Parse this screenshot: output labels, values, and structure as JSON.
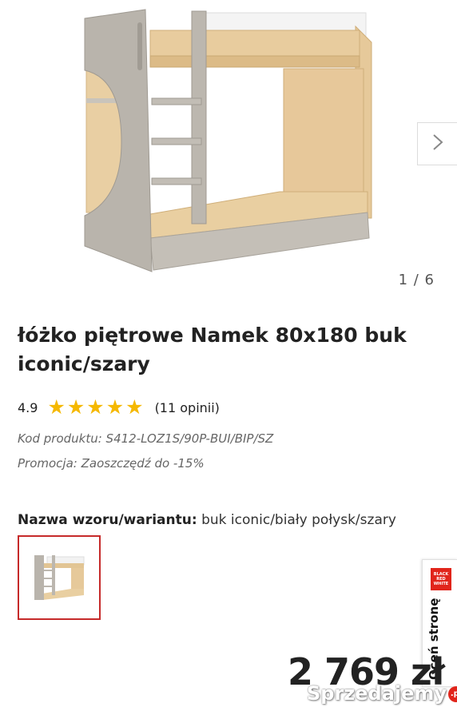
{
  "gallery": {
    "counter": "1 / 6",
    "next_icon": "chevron-right-icon",
    "image": "bunk-bed-product-photo"
  },
  "product": {
    "title": "łóżko piętrowe Namek 80x180 buk iconic/szary",
    "rating_value": "4.9",
    "stars": 5,
    "reviews": "(11 opinii)",
    "code": "Kod produktu: S412-LOZ1S/90P-BUI/BIP/SZ",
    "promo": "Promocja: Zaoszczędź do -15%",
    "variant_label": "Nazwa wzoru/wariantu:",
    "variant_value": "buk iconic/biały połysk/szary",
    "price": "2 769 zł"
  },
  "side_widget": {
    "logo_lines": [
      "BLACK",
      "RED",
      "WHITE"
    ],
    "label": "Oceń stronę"
  },
  "watermark": {
    "text": "Sprzedajemy",
    "badge": ".pl"
  },
  "colors": {
    "star": "#f5b800",
    "accent": "#c62a2a",
    "brand_red": "#e1251b",
    "wood": "#e6c99a",
    "panel_grey": "#b7b2aa"
  }
}
